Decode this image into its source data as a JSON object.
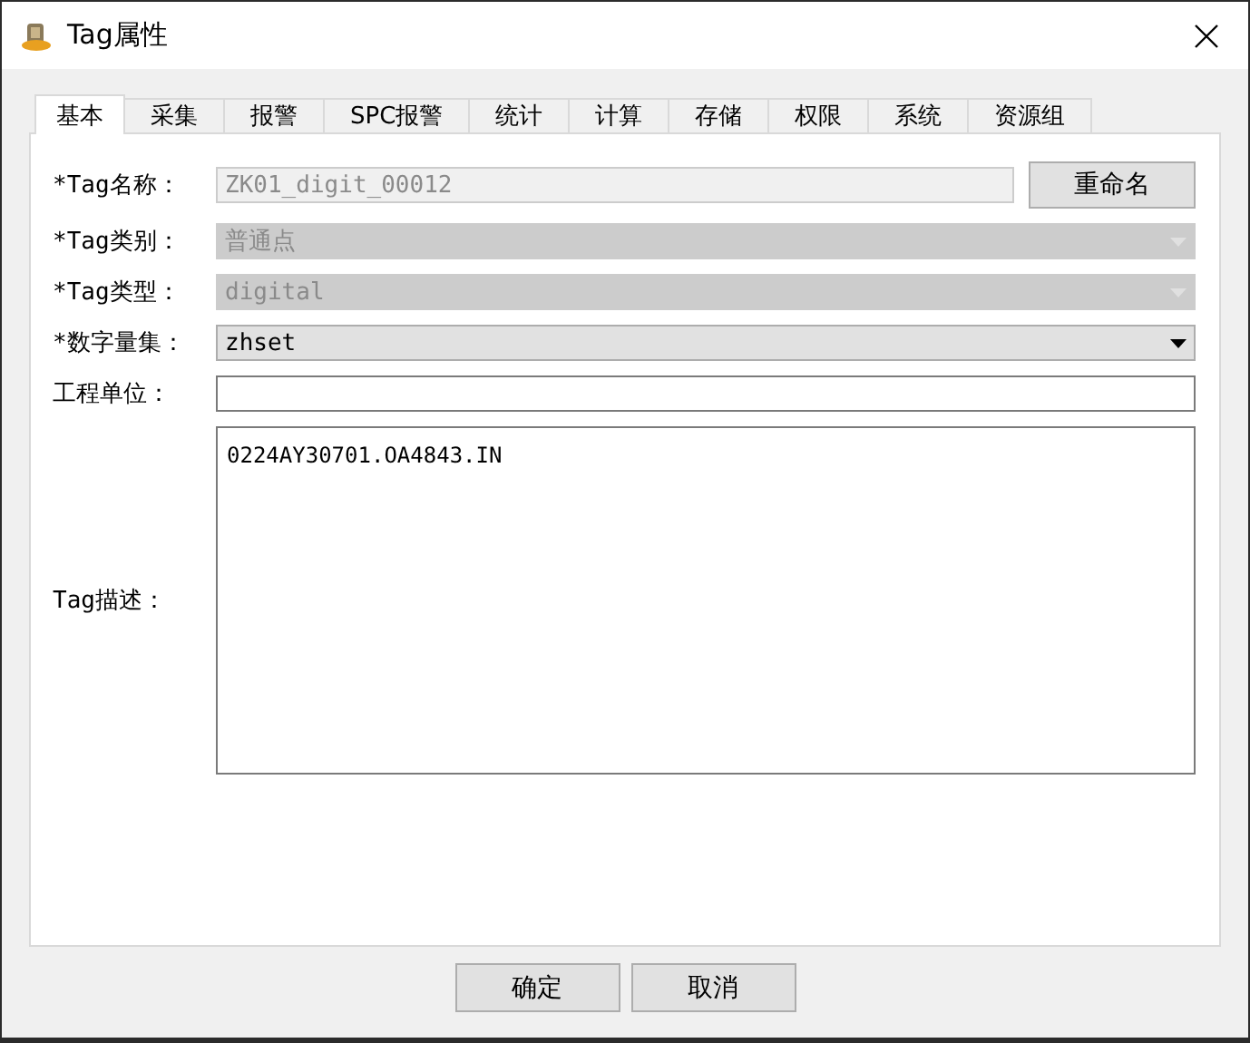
{
  "window": {
    "title": "Tag属性"
  },
  "tabs": [
    {
      "label": "基本",
      "selected": true
    },
    {
      "label": "采集",
      "selected": false
    },
    {
      "label": "报警",
      "selected": false
    },
    {
      "label": "SPC报警",
      "selected": false
    },
    {
      "label": "统计",
      "selected": false
    },
    {
      "label": "计算",
      "selected": false
    },
    {
      "label": "存储",
      "selected": false
    },
    {
      "label": "权限",
      "selected": false
    },
    {
      "label": "系统",
      "selected": false
    },
    {
      "label": "资源组",
      "selected": false
    }
  ],
  "fields": [
    {
      "kind": "text",
      "label": "*Tag名称：",
      "value": "ZK01_digit_00012",
      "disabled": true,
      "button": "重命名"
    },
    {
      "kind": "combo",
      "label": "*Tag类别：",
      "value": "普通点",
      "disabled": true
    },
    {
      "kind": "combo",
      "label": "*Tag类型：",
      "value": "digital",
      "disabled": true
    },
    {
      "kind": "combo",
      "label": "*数字量集：",
      "value": "zhset",
      "disabled": false
    },
    {
      "kind": "text",
      "label": "工程单位：",
      "disabled": false
    },
    {
      "kind": "textarea",
      "label": "Tag描述：",
      "value": "0224AY30701.OA4843.IN"
    }
  ],
  "buttons": [
    "确定",
    "取消"
  ]
}
